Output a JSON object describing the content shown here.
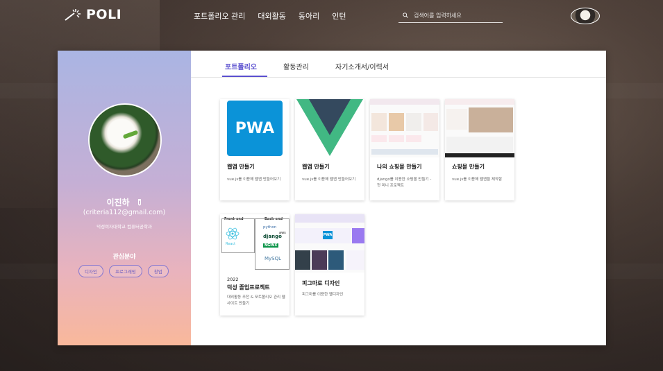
{
  "nav": {
    "logo": "POLI",
    "menu": [
      "포트폴리오 관리",
      "대외활동",
      "동아리",
      "인턴"
    ],
    "search_placeholder": "검색어를 입력하세요"
  },
  "profile": {
    "name": "이진하",
    "email": "(criteria112@gmail.com)",
    "school": "덕성여자대학교 컴퓨터공학과",
    "interest_title": "관심분야",
    "tags": [
      "디자인",
      "프로그래밍",
      "창업"
    ]
  },
  "tabs": [
    "포트폴리오",
    "활동관리",
    "자기소개서/이력서"
  ],
  "projects": [
    {
      "title": "웹앱 만들기",
      "desc": "vue.js를 이용해 웹앱 만들어보기",
      "thumb": "PWA"
    },
    {
      "title": "웹앱 만들기",
      "desc": "vue.js를 이용해 웹앱 만들어보기"
    },
    {
      "title": "나의 쇼핑몰 만들기",
      "desc": "django를 이용한 쇼핑몰 만들기 - 첫 미니 프로젝트"
    },
    {
      "title": "쇼핑몰 만들기",
      "desc": "vue.js를 이용해 웹앱을 제작함"
    },
    {
      "title_year": "2022",
      "title": "덕성 졸업프로젝트",
      "desc": "대외활동 추천 & 포트폴리오 관리 웹사이트 만들기",
      "labels": {
        "front": "Front-end",
        "back": "Back-end",
        "react": "React",
        "python": "python",
        "django": "django",
        "aws": "aws",
        "nginx": "NGINX",
        "mysql": "MySQL"
      }
    },
    {
      "title": "피그마로 디자인",
      "desc": "피그마를 이용한 웹디자인",
      "thumb_badge": "PWA"
    }
  ],
  "colors": {
    "accent": "#5a4fcf",
    "pwa": "#0b93d8",
    "vue_green": "#41b883",
    "vue_dark": "#34495e"
  }
}
